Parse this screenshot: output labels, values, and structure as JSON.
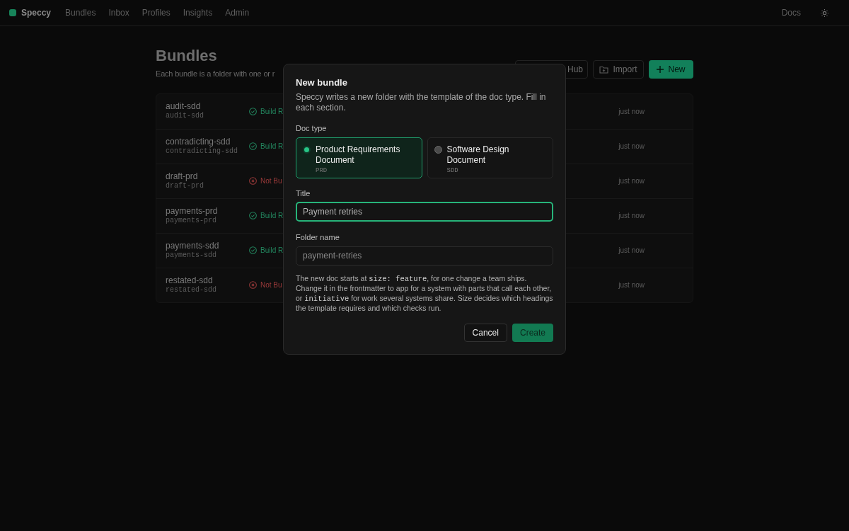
{
  "nav": {
    "brand": "Speccy",
    "links": [
      {
        "label": "Bundles"
      },
      {
        "label": "Inbox"
      },
      {
        "label": "Profiles"
      },
      {
        "label": "Insights"
      },
      {
        "label": "Admin"
      }
    ],
    "docs": "Docs"
  },
  "page": {
    "title": "Bundles",
    "subtitle": "Each bundle is a folder with one or r",
    "actions": [
      {
        "kind": "hub",
        "label": "Hub"
      },
      {
        "kind": "import",
        "label": "Import"
      },
      {
        "kind": "new",
        "label": "New"
      }
    ]
  },
  "bundles": [
    {
      "name": "audit-sdd",
      "folder": "audit-sdd",
      "status": "Build R",
      "ok": true,
      "time": "just now"
    },
    {
      "name": "contradicting-sdd",
      "folder": "contradicting-sdd",
      "status": "Build R",
      "ok": true,
      "time": "just now"
    },
    {
      "name": "draft-prd",
      "folder": "draft-prd",
      "status": "Not Bu",
      "ok": false,
      "time": "just now"
    },
    {
      "name": "payments-prd",
      "folder": "payments-prd",
      "status": "Build R",
      "ok": true,
      "time": "just now"
    },
    {
      "name": "payments-sdd",
      "folder": "payments-sdd",
      "status": "Build R",
      "ok": true,
      "time": "just now"
    },
    {
      "name": "restated-sdd",
      "folder": "restated-sdd",
      "status": "Not Bu",
      "ok": false,
      "time": "just now"
    }
  ],
  "dialog": {
    "title": "New bundle",
    "description": "Speccy writes a new folder with the template of the doc type. Fill in each section.",
    "doc_type_label": "Doc type",
    "doc_types": [
      {
        "name": "Product Requirements Document",
        "code": "PRD",
        "selected": true
      },
      {
        "name": "Software Design Document",
        "code": "SDD",
        "selected": false
      }
    ],
    "title_label": "Title",
    "title_value": "Payment retries",
    "folder_label": "Folder name",
    "folder_placeholder": "payment-retries",
    "help": [
      {
        "kind": "text",
        "text": "The new doc starts at "
      },
      {
        "kind": "code",
        "text": "size: feature"
      },
      {
        "kind": "text",
        "text": ", for one change a team ships. Change it in the frontmatter to app for a system with parts that call each other, or "
      },
      {
        "kind": "code",
        "text": "initiative"
      },
      {
        "kind": "text",
        "text": " for work several systems share. Size decides which headings the template requires and which checks run."
      }
    ],
    "buttons": [
      {
        "kind": "cancel",
        "label": "Cancel"
      },
      {
        "kind": "create",
        "label": "Create"
      }
    ]
  }
}
